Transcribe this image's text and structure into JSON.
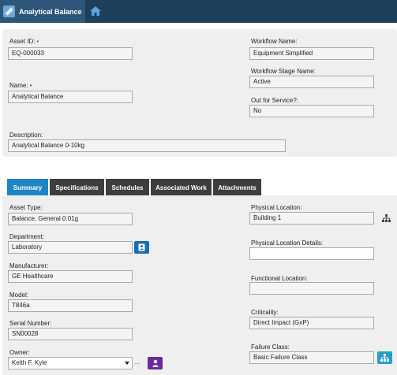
{
  "app": {
    "title": "Analytical Balance",
    "logo_icon": "balance-logo-icon",
    "home_icon": "home-icon"
  },
  "header": {
    "asset_id": {
      "label": "Asset ID:",
      "required_mark": "•",
      "value": "EQ-000033"
    },
    "name": {
      "label": "Name:",
      "required_mark": "•",
      "value": "Analytical Balance"
    },
    "description": {
      "label": "Description:",
      "value": "Analytical Balance 0-10kg"
    },
    "workflow_name": {
      "label": "Workflow Name:",
      "value": "Equipment Simplified"
    },
    "workflow_stage": {
      "label": "Workflow Stage Name:",
      "value": "Active"
    },
    "out_of_service": {
      "label": "Out for Service?:",
      "value": "No"
    }
  },
  "tabs": [
    "Summary",
    "Specifications",
    "Schedules",
    "Associated Work",
    "Attachments"
  ],
  "active_tab": "Summary",
  "summary": {
    "asset_type": {
      "label": "Asset Type:",
      "value": "Balance, General 0.01g"
    },
    "department": {
      "label": "Department:",
      "value": "Laboratory"
    },
    "manufacturer": {
      "label": "Manufacturer:",
      "value": "GE Healthcare"
    },
    "model": {
      "label": "Model:",
      "value": "T846a"
    },
    "serial_number": {
      "label": "Serial Number:",
      "value": "SN00028"
    },
    "owner": {
      "label": "Owner:",
      "value": "Keith F. Kyle",
      "more_label": "..."
    },
    "physical_location": {
      "label": "Physical Location:",
      "value": "Building 1"
    },
    "physical_location_details": {
      "label": "Physical Location Details:",
      "value": ""
    },
    "functional_location": {
      "label": "Functional Location:",
      "value": ""
    },
    "criticality": {
      "label": "Criticality:",
      "value": "Direct Impact (GxP)"
    },
    "failure_class": {
      "label": "Failure Class:",
      "value": "Basic Failure Class"
    }
  },
  "colors": {
    "topbar": "#1e3f5a",
    "tab_active": "#1f84c4",
    "tab_inactive": "#3d3d3d",
    "required": "#d9252a",
    "contact_button": "#1a6fb3",
    "owner_button": "#6b2a9e",
    "failure_button": "#2a9ec6"
  }
}
